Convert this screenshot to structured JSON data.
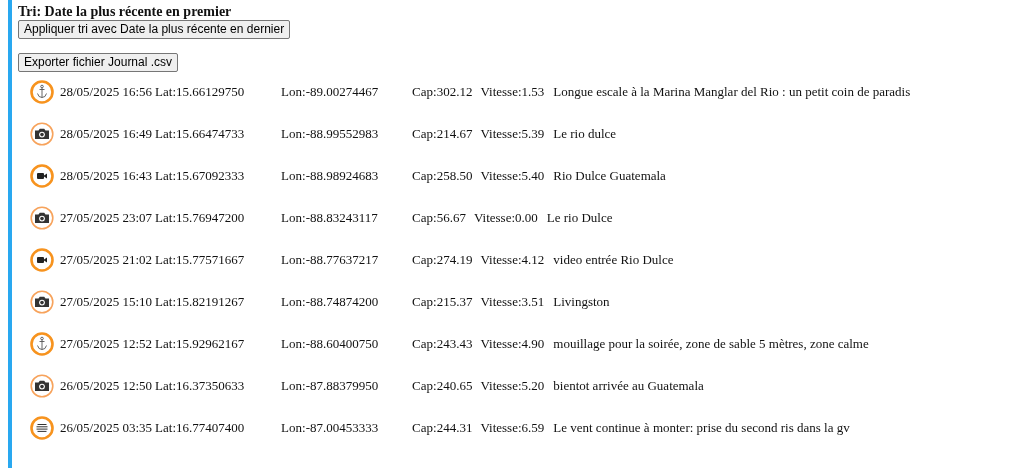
{
  "sort_label": "Tri: Date la plus récente en premier",
  "sort_button": "Appliquer tri avec Date la plus récente en dernier",
  "export_button": "Exporter fichier Journal .csv",
  "entries": [
    {
      "kind": "anchor",
      "datetime": "28/05/2025 16:56",
      "lat": "Lat:15.66129750",
      "lon": "Lon:-89.00274467",
      "cap": "Cap:302.12",
      "vitesse": "Vitesse:1.53",
      "comment": "Longue escale à la Marina Manglar del Rio : un petit coin de paradis"
    },
    {
      "kind": "photo",
      "datetime": "28/05/2025 16:49",
      "lat": "Lat:15.66474733",
      "lon": "Lon:-88.99552983",
      "cap": "Cap:214.67",
      "vitesse": "Vitesse:5.39",
      "comment": "Le rio dulce"
    },
    {
      "kind": "video",
      "datetime": "28/05/2025 16:43",
      "lat": "Lat:15.67092333",
      "lon": "Lon:-88.98924683",
      "cap": "Cap:258.50",
      "vitesse": "Vitesse:5.40",
      "comment": "Rio Dulce Guatemala"
    },
    {
      "kind": "photo",
      "datetime": "27/05/2025 23:07",
      "lat": "Lat:15.76947200",
      "lon": "Lon:-88.83243117",
      "cap": "Cap:56.67",
      "vitesse": "Vitesse:0.00",
      "comment": "Le rio Dulce"
    },
    {
      "kind": "video",
      "datetime": "27/05/2025 21:02",
      "lat": "Lat:15.77571667",
      "lon": "Lon:-88.77637217",
      "cap": "Cap:274.19",
      "vitesse": "Vitesse:4.12",
      "comment": "video entrée Rio Dulce"
    },
    {
      "kind": "photo",
      "datetime": "27/05/2025 15:10",
      "lat": "Lat:15.82191267",
      "lon": "Lon:-88.74874200",
      "cap": "Cap:215.37",
      "vitesse": "Vitesse:3.51",
      "comment": "Livingston"
    },
    {
      "kind": "anchor",
      "datetime": "27/05/2025 12:52",
      "lat": "Lat:15.92962167",
      "lon": "Lon:-88.60400750",
      "cap": "Cap:243.43",
      "vitesse": "Vitesse:4.90",
      "comment": "mouillage pour la soirée, zone de sable 5 mètres, zone calme"
    },
    {
      "kind": "photo",
      "datetime": "26/05/2025 12:50",
      "lat": "Lat:16.37350633",
      "lon": "Lon:-87.88379950",
      "cap": "Cap:240.65",
      "vitesse": "Vitesse:5.20",
      "comment": "bientot arrivée au Guatemala"
    },
    {
      "kind": "note",
      "datetime": "26/05/2025 03:35",
      "lat": "Lat:16.77407400",
      "lon": "Lon:-87.00453333",
      "cap": "Cap:244.31",
      "vitesse": "Vitesse:6.59",
      "comment": "Le vent continue à monter: prise du second ris dans la gv"
    }
  ]
}
